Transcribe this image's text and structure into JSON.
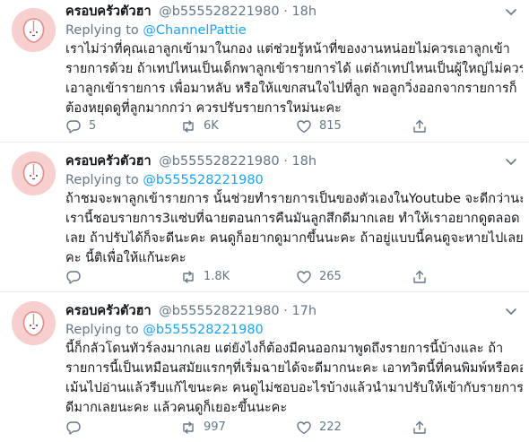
{
  "tweets": [
    {
      "name": "ครอบครัวตัวฮา",
      "handle": "@b555528221980",
      "dot": "·",
      "time": "18h",
      "replying_prefix": "Replying to",
      "replying_to": "@ChannelPattie",
      "body": [
        "เราไม่ว่าที่คุณเอาลูกเข้ามาในกอง แต่ช่วยรู้หน้าที่ของงานหน่อยไม่ควรเอาลูกเข้า",
        "รายการด้วย ถ้าเทปไหนเป็นเด็กพาลูกเข้ารายการได้ แต่ถ้าเทปไหนเป็นผู้ใหญ่ไม่ควร",
        "เอาลูกเข้ารายการ เพื่อมาหลับ หรือให้แขกสนใจไปที่ลูก พอลูกวิ่งออกจากรายการก็",
        "ต้องหยุดดูที่ลูกมากกว่า ควรปรับรายการใหม่นะคะ"
      ],
      "replies": "5",
      "retweets": "6K",
      "likes": "815"
    },
    {
      "name": "ครอบครัวตัวฮา",
      "handle": "@b555528221980",
      "dot": "·",
      "time": "18h",
      "replying_prefix": "Replying to",
      "replying_to": "@b555528221980",
      "body": [
        "ถ้าชมจะพาลูกเข้ารายการ นั้นช่วยทำรายการเป็นของตัวเองในYoutube จะดีกว่านะคะ",
        "เรานี้ชอบรายการ3แซ่บที่ฉายตอนการคืนมันลูกสึกดีมากเลย ทำให้เราอยากดูตลอด",
        "เลย ถ้าปรับได้ก็จะดีนะคะ คนดูก็อยากดูมากขึ้นนะคะ ถ้าอยู่แบบนี้คนดูจะหายไปเลยนะ",
        "คะ นี้ติเพื่อให้แก้นะคะ"
      ],
      "replies": "",
      "retweets": "1.8K",
      "likes": "265"
    },
    {
      "name": "ครอบครัวตัวฮา",
      "handle": "@b555528221980",
      "dot": "·",
      "time": "17h",
      "replying_prefix": "Replying to",
      "replying_to": "@b555528221980",
      "body": [
        "นี้ก็กลัวโดนทัวร์ลงมากเลย แต่ยังไงก็ต้องมีคนออกมาพูดถึงรายการนี้บ้างและ ถ้า",
        "รายการนี้เป็นเหมือนสมัยแรกๆที่เริ่มฉายได้จะดีมากนะคะ เอาทวิตนี้ที่คนพิมพ์หรือคอม",
        "เม้นไปอ่านแล้วรีบแก้ไขนะคะ คนดูไม่ชอบอะไรบ้างแล้วนำมาปรับให้เข้ากับรายการจะ",
        "ดีมากเลยนะคะ แล้วคนดูก็เยอะขึ้นนะคะ"
      ],
      "replies": "",
      "retweets": "997",
      "likes": "222"
    }
  ],
  "icons": {
    "reply": "reply-icon",
    "retweet": "retweet-icon",
    "like": "heart-icon",
    "share": "share-icon",
    "more": "chevron-down-icon"
  },
  "colors": {
    "link": "#1da1f2",
    "secondary": "#657786",
    "avatar_bg": "#f6cccc"
  }
}
